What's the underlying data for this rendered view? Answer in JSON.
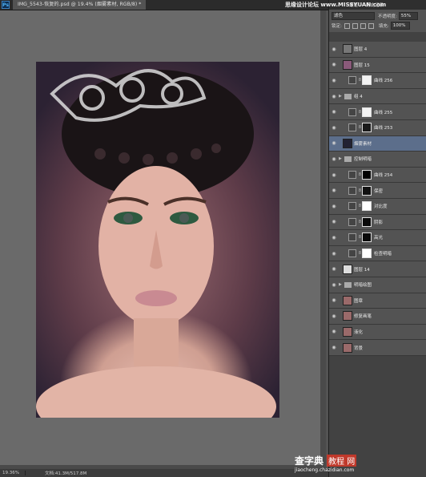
{
  "title_bar": {
    "app_icon": "photoshop-icon",
    "doc_tab": "IMG_5543-恢复的.psd @ 19.4% (烟雾素材, RGB/8) *"
  },
  "status_bar": {
    "zoom": "19.36%",
    "doc_size": "文档:41.3M/517.8M"
  },
  "panel": {
    "tabs": [
      "通道",
      "历史记录"
    ],
    "blend_mode": "滤色",
    "opacity_label": "不透明度:",
    "opacity_value": "55%",
    "lock_label": "锁定:",
    "fill_label": "填充:",
    "fill_value": "100%"
  },
  "layers": [
    {
      "name": "图层 4",
      "type": "pixel",
      "thumb": "#777777"
    },
    {
      "name": "图层 15",
      "type": "pixel",
      "thumb": "#8a5a7a"
    },
    {
      "name": "曲线 256",
      "type": "adjustment",
      "mask": "#f2f2f2"
    },
    {
      "name": "组 4",
      "type": "group"
    },
    {
      "name": "曲线 255",
      "type": "adjustment",
      "mask": "#f2f2f2"
    },
    {
      "name": "曲线 253",
      "type": "adjustment",
      "mask": "#1a1a1a"
    },
    {
      "name": "烟雾素材",
      "type": "pixel",
      "thumb": "#222233",
      "selected": true
    },
    {
      "name": "控制明暗",
      "type": "group"
    },
    {
      "name": "曲线 254",
      "type": "adjustment",
      "mask": "#000000"
    },
    {
      "name": "保密",
      "type": "adjustment",
      "mask": "#111111"
    },
    {
      "name": "对比度",
      "type": "adjustment",
      "mask": "#ffffff"
    },
    {
      "name": "阴影",
      "type": "adjustment",
      "mask": "#0a0a0a"
    },
    {
      "name": "高光",
      "type": "adjustment",
      "mask": "#0a0a0a"
    },
    {
      "name": "检查明暗",
      "type": "adjustment",
      "mask": "#ffffff"
    },
    {
      "name": "图层 14",
      "type": "pixel",
      "thumb": "#dddddd"
    },
    {
      "name": "明暗绘图",
      "type": "group"
    },
    {
      "name": "图章",
      "type": "pixel",
      "thumb": "#9a6a6a"
    },
    {
      "name": "修复画笔",
      "type": "pixel",
      "thumb": "#9a6a6a"
    },
    {
      "name": "液化",
      "type": "pixel",
      "thumb": "#9a6a6a"
    },
    {
      "name": "背景",
      "type": "pixel",
      "thumb": "#9a6a6a"
    }
  ],
  "watermarks": {
    "top": "思缘设计论坛 www.MISSYUAN.com",
    "bottom_cn": "查字典",
    "bottom_mid": "教程 网",
    "bottom_url": "jiaocheng.chazidian.com"
  },
  "colors": {
    "selected_layer": "#5c6e8b",
    "panel_bg": "#535353"
  }
}
